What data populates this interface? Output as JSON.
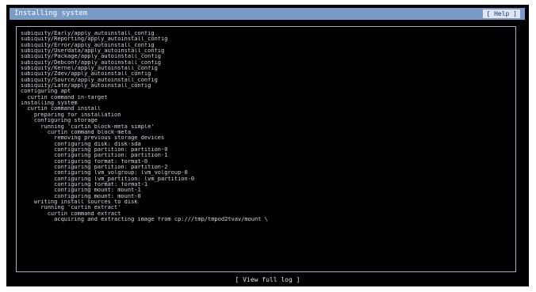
{
  "window": {
    "title": "Installing system",
    "help_label": "[ Help ]"
  },
  "log": {
    "lines": [
      "subiquity/Early/apply_autoinstall_config",
      "subiquity/Reporting/apply_autoinstall_config",
      "subiquity/Error/apply_autoinstall_config",
      "subiquity/Userdata/apply_autoinstall_config",
      "subiquity/Package/apply_autoinstall_config",
      "subiquity/Debconf/apply_autoinstall_config",
      "subiquity/Kernel/apply_autoinstall_config",
      "subiquity/Zdev/apply_autoinstall_config",
      "subiquity/Source/apply_autoinstall_config",
      "subiquity/Late/apply_autoinstall_config",
      "configuring apt",
      "  curtin command in-target",
      "installing system",
      "  curtin command install",
      "    preparing for installation",
      "    configuring storage",
      "      running 'curtin block-meta simple'",
      "        curtin command block-meta",
      "          removing previous storage devices",
      "          configuring disk: disk-sda",
      "          configuring partition: partition-0",
      "          configuring partition: partition-1",
      "          configuring format: format-0",
      "          configuring partition: partition-2",
      "          configuring lvm_volgroup: lvm_volgroup-0",
      "          configuring lvm_partition: lvm_partition-0",
      "          configuring format: format-1",
      "          configuring mount: mount-1",
      "          configuring mount: mount-0",
      "    writing install sources to disk",
      "      running 'curtin extract'",
      "        curtin command extract",
      "          acquiring and extracting image from cp:///tmp/tmpod2tvav/mount \\"
    ]
  },
  "footer": {
    "view_log_label": "[ View full log ]"
  }
}
